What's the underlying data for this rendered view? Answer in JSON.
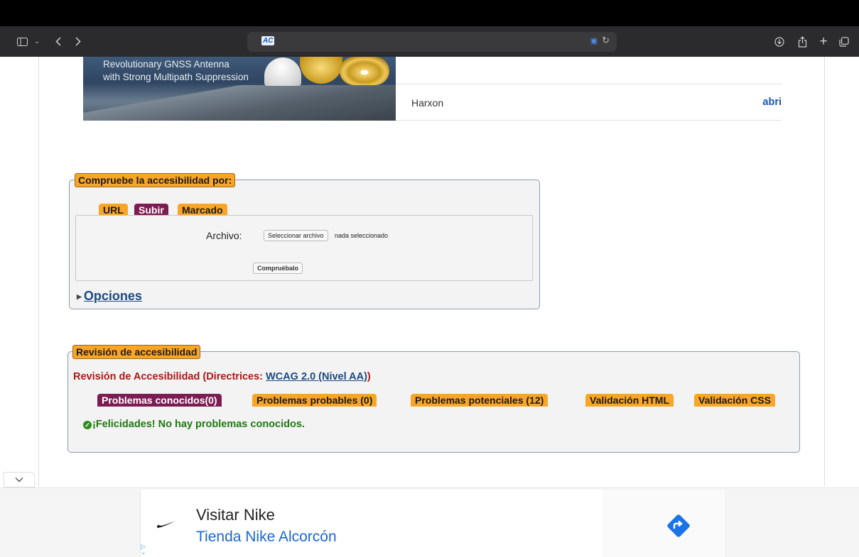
{
  "browser": {
    "favicon_text": "AC",
    "icons": [
      "sidebar-icon",
      "chevron-down-icon",
      "back-icon",
      "forward-icon",
      "translate-icon",
      "reload-icon",
      "download-icon",
      "share-icon",
      "new-tab-icon",
      "tabs-icon"
    ]
  },
  "banner": {
    "line1": "Revolutionary GNSS Antenna",
    "line2": "with Strong Multipath Suppression",
    "advertiser": "Harxon",
    "open_link": "abri"
  },
  "check_form": {
    "legend": "Compruebe la accesibilidad por:",
    "tabs": [
      "URL",
      "Subir",
      "Marcado"
    ],
    "active_tab": "Subir",
    "file_label": "Archivo:",
    "file_button": "Seleccionar archivo",
    "file_note": "nada seleccionado",
    "check_button": "Compruébalo",
    "options_link": "Opciones"
  },
  "review": {
    "legend": "Revisión de accesibilidad",
    "title_prefix": "Revisión de Accesibilidad (Directrices: ",
    "guideline_link": "WCAG 2.0 (Nivel AA)",
    "title_suffix": ")",
    "tabs": [
      "Problemas conocidos(0)",
      "Problemas probables (0)",
      "Problemas potenciales (12)",
      "Validación HTML",
      "Validación CSS"
    ],
    "active_tab": "Problemas conocidos(0)",
    "message": "¡Felicidades! No hay problemas conocidos."
  },
  "ad": {
    "title": "Visitar Nike",
    "subtitle": "Tienda Nike Alcorcón"
  },
  "colors": {
    "tab_orange": "#f9a526",
    "tab_purple": "#7b1d52",
    "review_red": "#b01616",
    "success_green": "#1f7a12",
    "link_blue": "#1c4a80"
  }
}
